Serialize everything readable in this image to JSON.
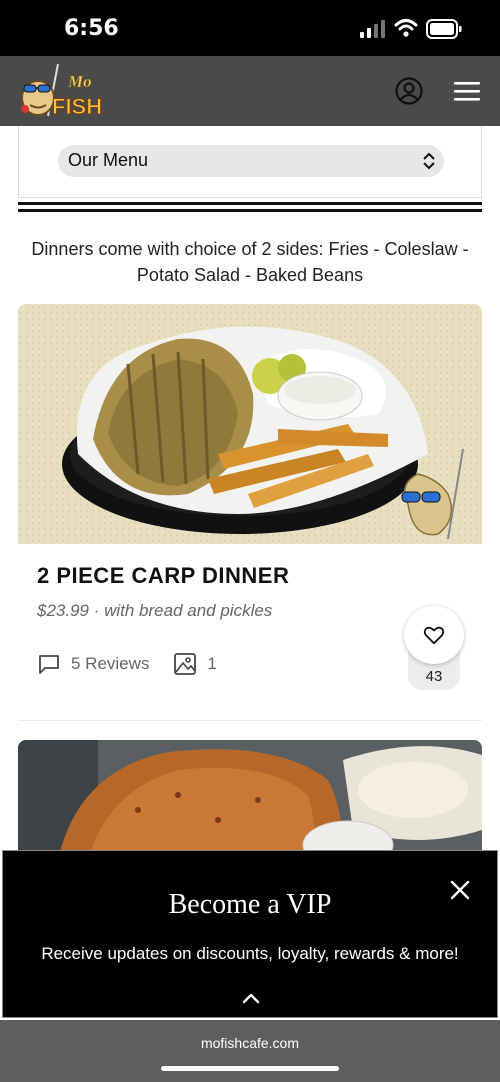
{
  "status_bar": {
    "time": "6:56"
  },
  "header": {
    "logo_text_top": "Mo",
    "logo_text_bottom": "FISH"
  },
  "menu_selector": {
    "selected": "Our Menu"
  },
  "intro_text": "Dinners come with choice of 2 sides: Fries - Coleslaw - Potato Salad - Baked Beans",
  "dishes": [
    {
      "title": "2 PIECE CARP DINNER",
      "description": "$23.99 · with bread and pickles",
      "reviews": "5 Reviews",
      "photos": "1",
      "likes": "43"
    }
  ],
  "vip_banner": {
    "title": "Become a VIP",
    "text": "Receive updates on discounts, loyalty, rewards & more!"
  },
  "browser": {
    "url": "mofishcafe.com"
  }
}
